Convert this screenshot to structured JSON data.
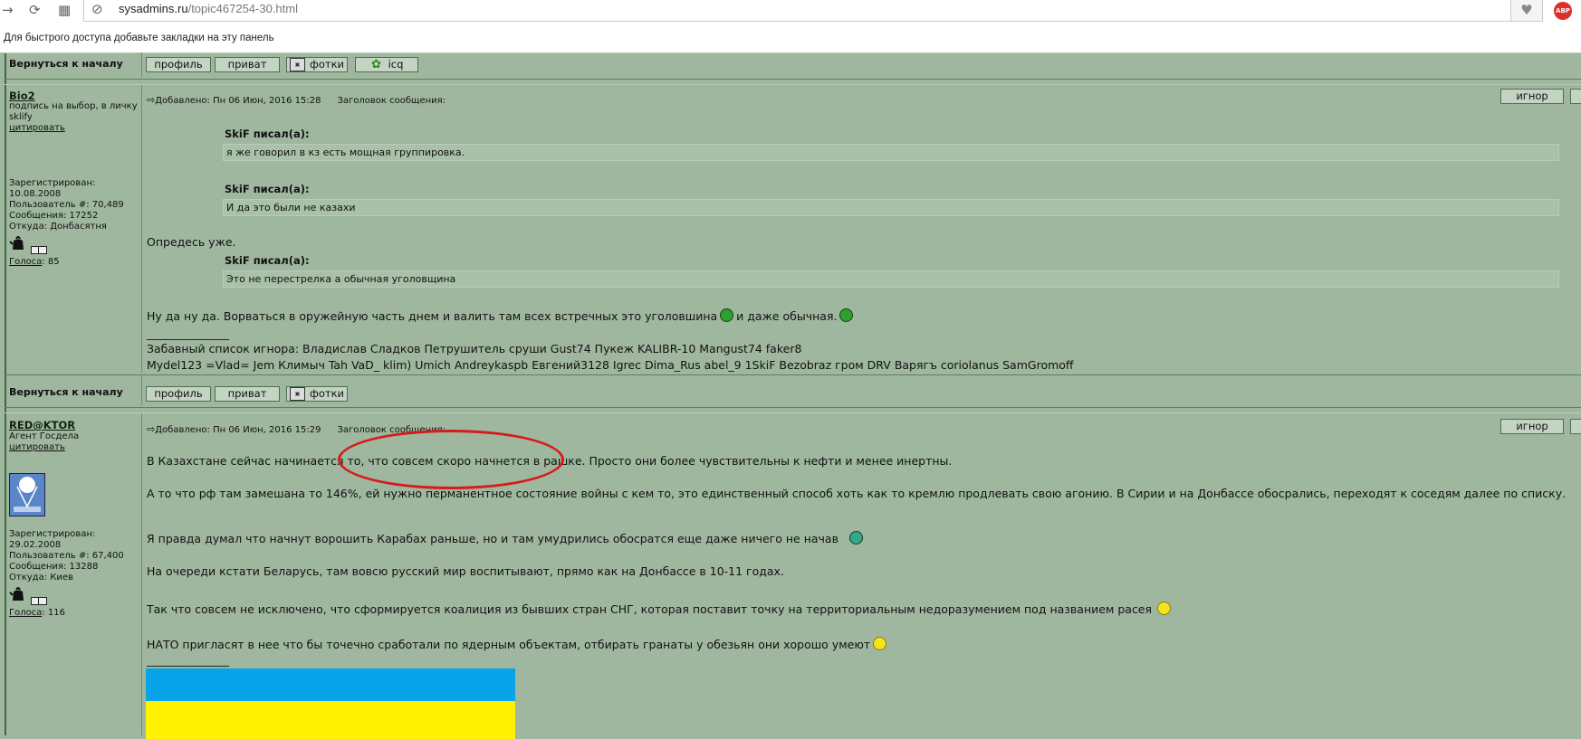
{
  "browser": {
    "url_domain": "sysadmins.ru",
    "url_path": "/topic467254-30.html",
    "bookmarks_text": "Для быстрого доступа добавьте закладки на эту панель",
    "abp_label": "ABP",
    "back_icon": "arrow-right-icon",
    "reload_icon": "reload-icon",
    "apps_icon": "apps-grid-icon",
    "site_icon": "compass-icon",
    "bookmark_icon": "heart-icon"
  },
  "toolbar1": {
    "back_to_top": "Вернуться к началу",
    "buttons": [
      "профиль",
      "приват",
      "фотки",
      "icq"
    ]
  },
  "toolbar2": {
    "back_to_top": "Вернуться к началу",
    "buttons": [
      "профиль",
      "приват",
      "фотки"
    ]
  },
  "post1": {
    "username": "Bio2",
    "user_status": "подпись на выбор, в личку",
    "user_status2": "sklify",
    "quote_link": "цитировать",
    "registered_label": "Зарегистрирован:",
    "registered_date": "10.08.2008",
    "user_number": "Пользователь #: 70,489",
    "messages": "Сообщения: 17252",
    "location": "Откуда: Донбасятня",
    "votes_label": "Голоса",
    "votes_count": ": 85",
    "header": "Добавлено: Пн 06 Июн, 2016 15:28",
    "header_label": "Заголовок сообщения:",
    "ignore": "игнор",
    "quotes": [
      {
        "author": "SkiF писал(а):",
        "text": "я же говорил в кз есть мощная группировка."
      },
      {
        "author": "SkiF писал(а):",
        "text": "И да это были не казахи"
      },
      {
        "author": "SkiF писал(а):",
        "text": "Это не перестрелка а обычная уголовщина"
      }
    ],
    "text_between": "Опредесь уже.",
    "text_main_1": "Ну да ну да. Ворваться в оружейную часть днем и валить там всех встречных это уголовшина",
    "text_main_2": "и даже обычная.",
    "sig_line": "__________________",
    "sig1": "Забавный список игнора: Владислав Сладков Петрушитель сруши Gust74 Пукеж KALIBR-10 Mangust74 faker8",
    "sig2": "Mydel123 =Vlad= Jem Климыч Tah VaD_ klim) Umich Andreykaspb Евгений3128 Igrec Dima_Rus abel_9 1SkiF Bezobraz гром DRV Варягъ coriolanus SamGromoff"
  },
  "post2": {
    "username": "RED@KTOR",
    "user_status": "Агент Госдела",
    "quote_link": "цитировать",
    "registered_label": "Зарегистрирован:",
    "registered_date": "29.02.2008",
    "user_number": "Пользователь #: 67,400",
    "messages": "Сообщения: 13288",
    "location": "Откуда: Киев",
    "votes_label": "Голоса",
    "votes_count": ": 116",
    "header": "Добавлено: Пн 06 Июн, 2016 15:29",
    "header_label": "Заголовок сообщения:",
    "ignore": "игнор",
    "lines": [
      "В Казахстане сейчас начинается то, что совсем скоро начнется в рашке. Просто они более чувствительны к нефти и менее инертны.",
      "А то что рф там замешана то 146%, ей нужно перманентное состояние войны с кем то, это единственный способ хоть как то кремлю продлевать свою агонию. В Сирии и на Донбассе обосрались, переходят к соседям далее по списку.",
      "Я правда думал что начнут ворошить Карабах раньше, но и там умудрились обосратся еще даже ничего не начав",
      "На очереди кстати Беларусь, там вовсю русский мир воспитывают, прямо как на Донбассе в 10-11 годах.",
      "Так что совсем не исключено, что сформируется коалиция из бывших стран СНГ, которая поставит точку на территориальным недоразумением под названием расея",
      "НАТО пригласят в нее что бы точечно сработали по ядерным объектам, отбирать гранаты у обезьян они хорошо умеют"
    ],
    "sig_line": "__________________"
  },
  "colors": {
    "background": "#9fb79f",
    "annotation_ring": "#d51c1c",
    "flag_blue": "#08a3e8",
    "flag_yellow": "#fff100"
  }
}
